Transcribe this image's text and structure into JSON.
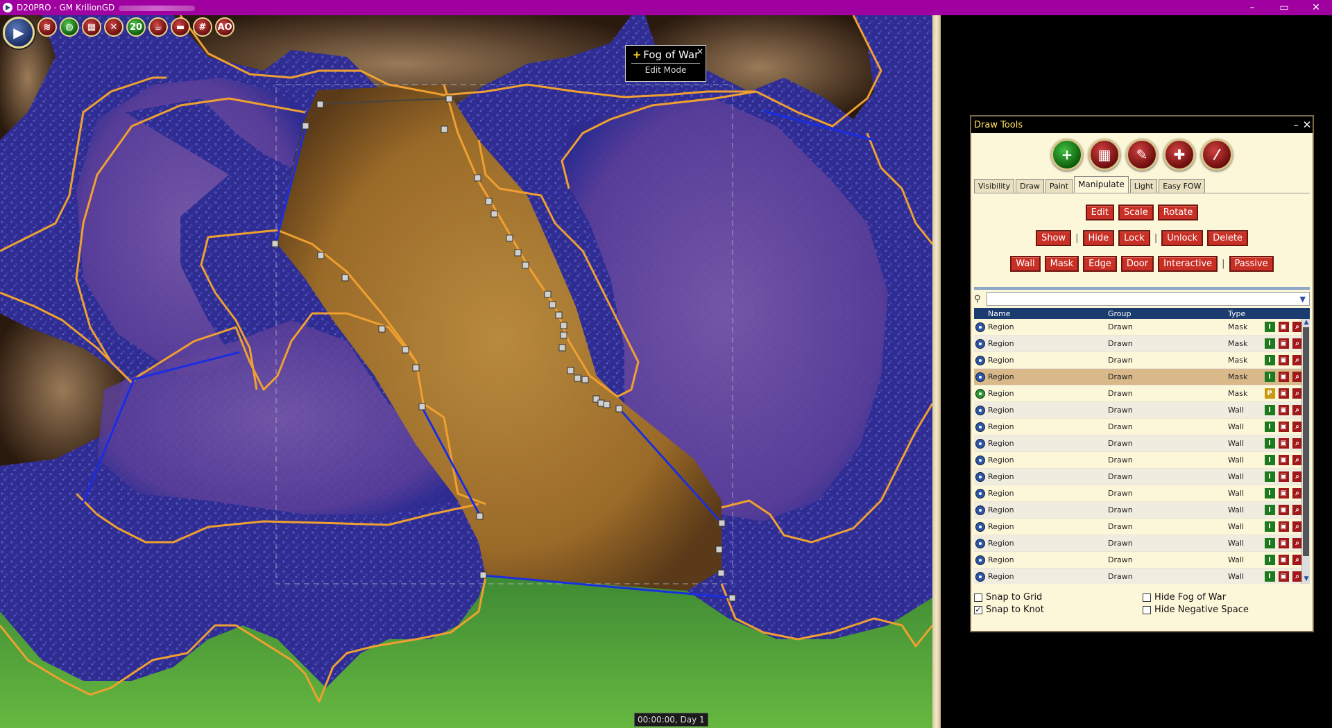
{
  "window": {
    "title": "D20PRO - GM KrilionGD",
    "minimize": "–",
    "maximize": "▭",
    "close": "✕"
  },
  "toolbar": {
    "main_icon": "d20pro-logo-icon",
    "buttons": [
      {
        "name": "wifi-icon",
        "glyph": "☰"
      },
      {
        "name": "globe-icon",
        "glyph": "◍"
      },
      {
        "name": "map-icon",
        "glyph": "▦"
      },
      {
        "name": "swords-icon",
        "glyph": "✕"
      },
      {
        "name": "d20-icon",
        "glyph": "20"
      },
      {
        "name": "mug-icon",
        "glyph": "☕"
      },
      {
        "name": "ruler-icon",
        "glyph": "▬"
      },
      {
        "name": "grid-icon",
        "glyph": "#"
      },
      {
        "name": "aoe-icon",
        "glyph": "AO"
      }
    ]
  },
  "fog_popup": {
    "title": "Fog of War",
    "mode": "Edit Mode",
    "close": "×"
  },
  "clock": "00:00:00, Day 1",
  "draw_tools": {
    "title": "Draw Tools",
    "minimize": "–",
    "close": "✕",
    "top_icons": [
      "add-icon",
      "select-grid-icon",
      "edit-pen-icon",
      "move-icon",
      "brush-icon"
    ],
    "tabs": [
      "Visibility",
      "Draw",
      "Paint",
      "Manipulate",
      "Light",
      "Easy FOW"
    ],
    "active_tab": "Manipulate",
    "row1": [
      "Edit",
      "Scale",
      "Rotate"
    ],
    "row2a": [
      "Show",
      "Hide"
    ],
    "row2b": [
      "Lock",
      "Unlock"
    ],
    "row2c": [
      "Delete"
    ],
    "row3a": [
      "Wall",
      "Mask",
      "Edge",
      "Door",
      "Interactive"
    ],
    "row3b": [
      "Passive"
    ],
    "search_placeholder": "",
    "columns": [
      "Name",
      "Group",
      "Type"
    ],
    "rows": [
      {
        "name": "Region",
        "group": "Drawn",
        "type": "Mask",
        "mode": "I",
        "vis": false
      },
      {
        "name": "Region",
        "group": "Drawn",
        "type": "Mask",
        "mode": "I",
        "vis": false
      },
      {
        "name": "Region",
        "group": "Drawn",
        "type": "Mask",
        "mode": "I",
        "vis": false
      },
      {
        "name": "Region",
        "group": "Drawn",
        "type": "Mask",
        "mode": "I",
        "vis": false,
        "selected": true
      },
      {
        "name": "Region",
        "group": "Drawn",
        "type": "Mask",
        "mode": "P",
        "vis": true
      },
      {
        "name": "Region",
        "group": "Drawn",
        "type": "Wall",
        "mode": "I",
        "vis": false
      },
      {
        "name": "Region",
        "group": "Drawn",
        "type": "Wall",
        "mode": "I",
        "vis": false
      },
      {
        "name": "Region",
        "group": "Drawn",
        "type": "Wall",
        "mode": "I",
        "vis": false
      },
      {
        "name": "Region",
        "group": "Drawn",
        "type": "Wall",
        "mode": "I",
        "vis": false
      },
      {
        "name": "Region",
        "group": "Drawn",
        "type": "Wall",
        "mode": "I",
        "vis": false
      },
      {
        "name": "Region",
        "group": "Drawn",
        "type": "Wall",
        "mode": "I",
        "vis": false
      },
      {
        "name": "Region",
        "group": "Drawn",
        "type": "Wall",
        "mode": "I",
        "vis": false
      },
      {
        "name": "Region",
        "group": "Drawn",
        "type": "Wall",
        "mode": "I",
        "vis": false
      },
      {
        "name": "Region",
        "group": "Drawn",
        "type": "Wall",
        "mode": "I",
        "vis": false
      },
      {
        "name": "Region",
        "group": "Drawn",
        "type": "Wall",
        "mode": "I",
        "vis": false
      },
      {
        "name": "Region",
        "group": "Drawn",
        "type": "Wall",
        "mode": "I",
        "vis": false
      }
    ],
    "checkboxes": [
      {
        "label": "Snap to Grid",
        "checked": false
      },
      {
        "label": "Hide Fog of War",
        "checked": false
      },
      {
        "label": "Snap to Knot",
        "checked": true
      },
      {
        "label": "Hide Negative Space",
        "checked": false
      }
    ]
  },
  "colors": {
    "title_bar": "#a000a0",
    "water": "#2c2a8a",
    "sand": "#a8762e",
    "grass": "#4f9a3a",
    "region_line": "#f0a030",
    "wall_line": "#1a2ee0"
  }
}
